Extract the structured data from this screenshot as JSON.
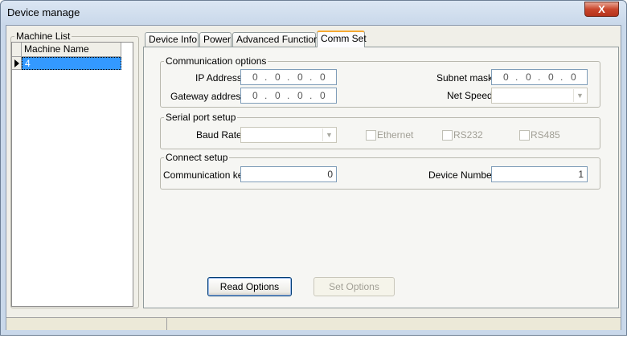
{
  "window": {
    "title": "Device manage",
    "close_glyph": "X"
  },
  "machine_list": {
    "legend": "Machine List",
    "column_header": "Machine Name",
    "rows": [
      {
        "name": "4",
        "selected": true
      }
    ]
  },
  "tabs": [
    {
      "label": "Device Info",
      "active": false
    },
    {
      "label": "Power",
      "active": false
    },
    {
      "label": "Advanced Function",
      "active": false
    },
    {
      "label": "Comm Set",
      "active": true
    }
  ],
  "comm_options": {
    "legend": "Communication options",
    "ip_label": "IP Address",
    "ip_octets": [
      "0",
      "0",
      "0",
      "0"
    ],
    "gateway_label": "Gateway address",
    "gateway_octets": [
      "0",
      "0",
      "0",
      "0"
    ],
    "subnet_label": "Subnet mask",
    "subnet_octets": [
      "0",
      "0",
      "0",
      "0"
    ],
    "net_speed_label": "Net Speed",
    "net_speed_value": ""
  },
  "serial_setup": {
    "legend": "Serial port setup",
    "baud_label": "Baud Rate",
    "baud_value": "",
    "ethernet_label": "Ethernet",
    "rs232_label": "RS232",
    "rs485_label": "RS485"
  },
  "connect_setup": {
    "legend": "Connect setup",
    "comm_key_label": "Communication key",
    "comm_key_value": "0",
    "device_number_label": "Device Number",
    "device_number_value": "1"
  },
  "buttons": {
    "read_options": "Read Options",
    "set_options": "Set Options"
  },
  "colors": {
    "selection": "#3399ff",
    "active_tab_accent": "#f5a933",
    "close_button": "#c9462c"
  }
}
